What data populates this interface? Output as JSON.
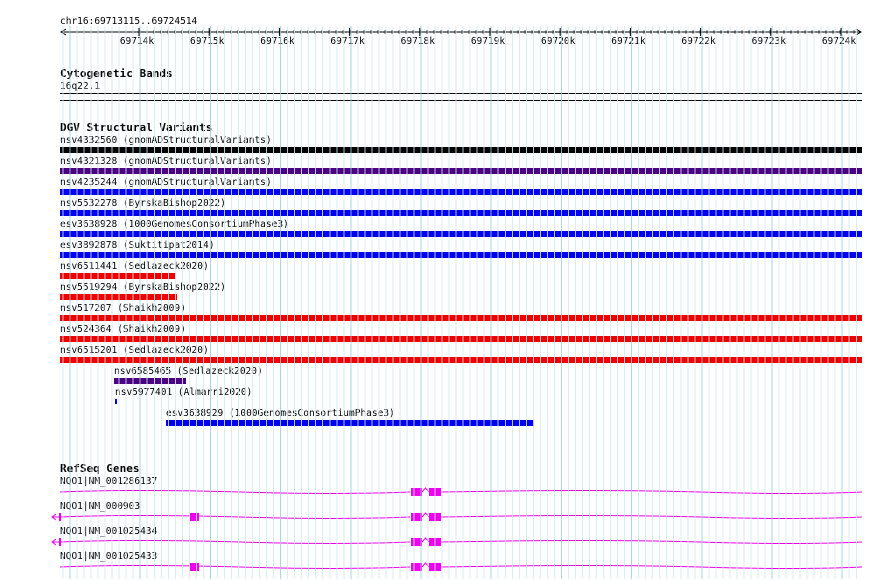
{
  "ruler": {
    "location": "chr16:69713115..69724514",
    "ticks": [
      "69714k",
      "69715k",
      "69716k",
      "69717k",
      "69718k",
      "69719k",
      "69720k",
      "69721k",
      "69722k",
      "69723k",
      "69724k"
    ]
  },
  "cytobands": {
    "title": "Cytogenetic Bands",
    "band": "16q22.1"
  },
  "dgv": {
    "title": "DGV Structural Variants",
    "features": [
      {
        "label": "nsv4332560 (gnomADStructuralVariants)",
        "color": "#000000"
      },
      {
        "label": "nsv4321328 (gnomADStructuralVariants)",
        "color": "#4b0082"
      },
      {
        "label": "nsv4235244 (gnomADStructuralVariants)",
        "color": "#0000ee"
      },
      {
        "label": "nsv5532278 (ByrskaBishop2022)",
        "color": "#0000ee"
      },
      {
        "label": "esv3638928 (1000GenomesConsortiumPhase3)",
        "color": "#0000ee"
      },
      {
        "label": "esv3892878 (Suktitipat2014)",
        "color": "#0000ee"
      },
      {
        "label": "nsv6511441 (Sedlazeck2020)",
        "color": "#ee0000"
      },
      {
        "label": "nsv5519294 (ByrskaBishop2022)",
        "color": "#ee0000"
      },
      {
        "label": "nsv517207 (Shaikh2009)",
        "color": "#ee0000"
      },
      {
        "label": "nsv524364 (Shaikh2009)",
        "color": "#ee0000"
      },
      {
        "label": "nsv6515201 (Sedlazeck2020)",
        "color": "#ee0000"
      },
      {
        "label": "nsv6585465 (Sedlazeck2020)",
        "color": "#4b0082"
      },
      {
        "label": "nsv5977401 (Almarri2020)",
        "color": "#0000ee"
      },
      {
        "label": "esv3638929 (1000GenomesConsortiumPhase3)",
        "color": "#0000ee"
      }
    ]
  },
  "refseq": {
    "title": "RefSeq Genes",
    "color": "#ee00ee",
    "genes": [
      {
        "label": "NQO1|NM_001286137"
      },
      {
        "label": "NQO1|NM_000903"
      },
      {
        "label": "NQO1|NM_001025434"
      },
      {
        "label": "NQO1|NM_001025433"
      }
    ]
  }
}
